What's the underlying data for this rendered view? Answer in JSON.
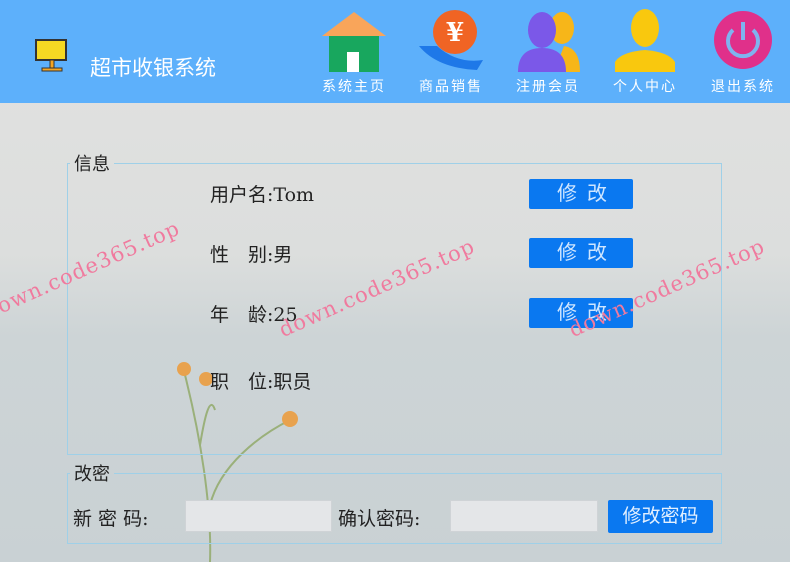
{
  "header": {
    "title": "超市收银系统",
    "nav": [
      {
        "label": "系统主页",
        "icon": "home-icon"
      },
      {
        "label": "商品销售",
        "icon": "yuan-hand-icon"
      },
      {
        "label": "注册会员",
        "icon": "members-icon"
      },
      {
        "label": "个人中心",
        "icon": "user-icon"
      },
      {
        "label": "退出系统",
        "icon": "power-icon"
      }
    ]
  },
  "info": {
    "legend": "信息",
    "rows": [
      {
        "text": "用户名:Tom"
      },
      {
        "text": "性　别:男"
      },
      {
        "text": "年　龄:25"
      },
      {
        "text": "职　位:职员"
      }
    ],
    "edit_label": "修改"
  },
  "password": {
    "legend": "改密",
    "new_label": "新 密 码:",
    "new_value": "",
    "confirm_label": "确认密码:",
    "confirm_value": "",
    "submit_label": "修改密码"
  },
  "watermark": "down.code365.top",
  "colors": {
    "header": "#5db0fb",
    "button": "#0a78f0"
  }
}
